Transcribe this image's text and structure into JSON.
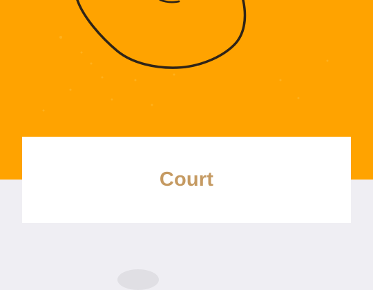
{
  "card": {
    "title": "Court"
  },
  "colors": {
    "hero_background": "#ffa300",
    "card_background": "#ffffff",
    "title_text": "#c59a62",
    "page_background": "#efeef3"
  },
  "icons": {
    "hero_art": "hand-drawn-circle-illustration"
  }
}
